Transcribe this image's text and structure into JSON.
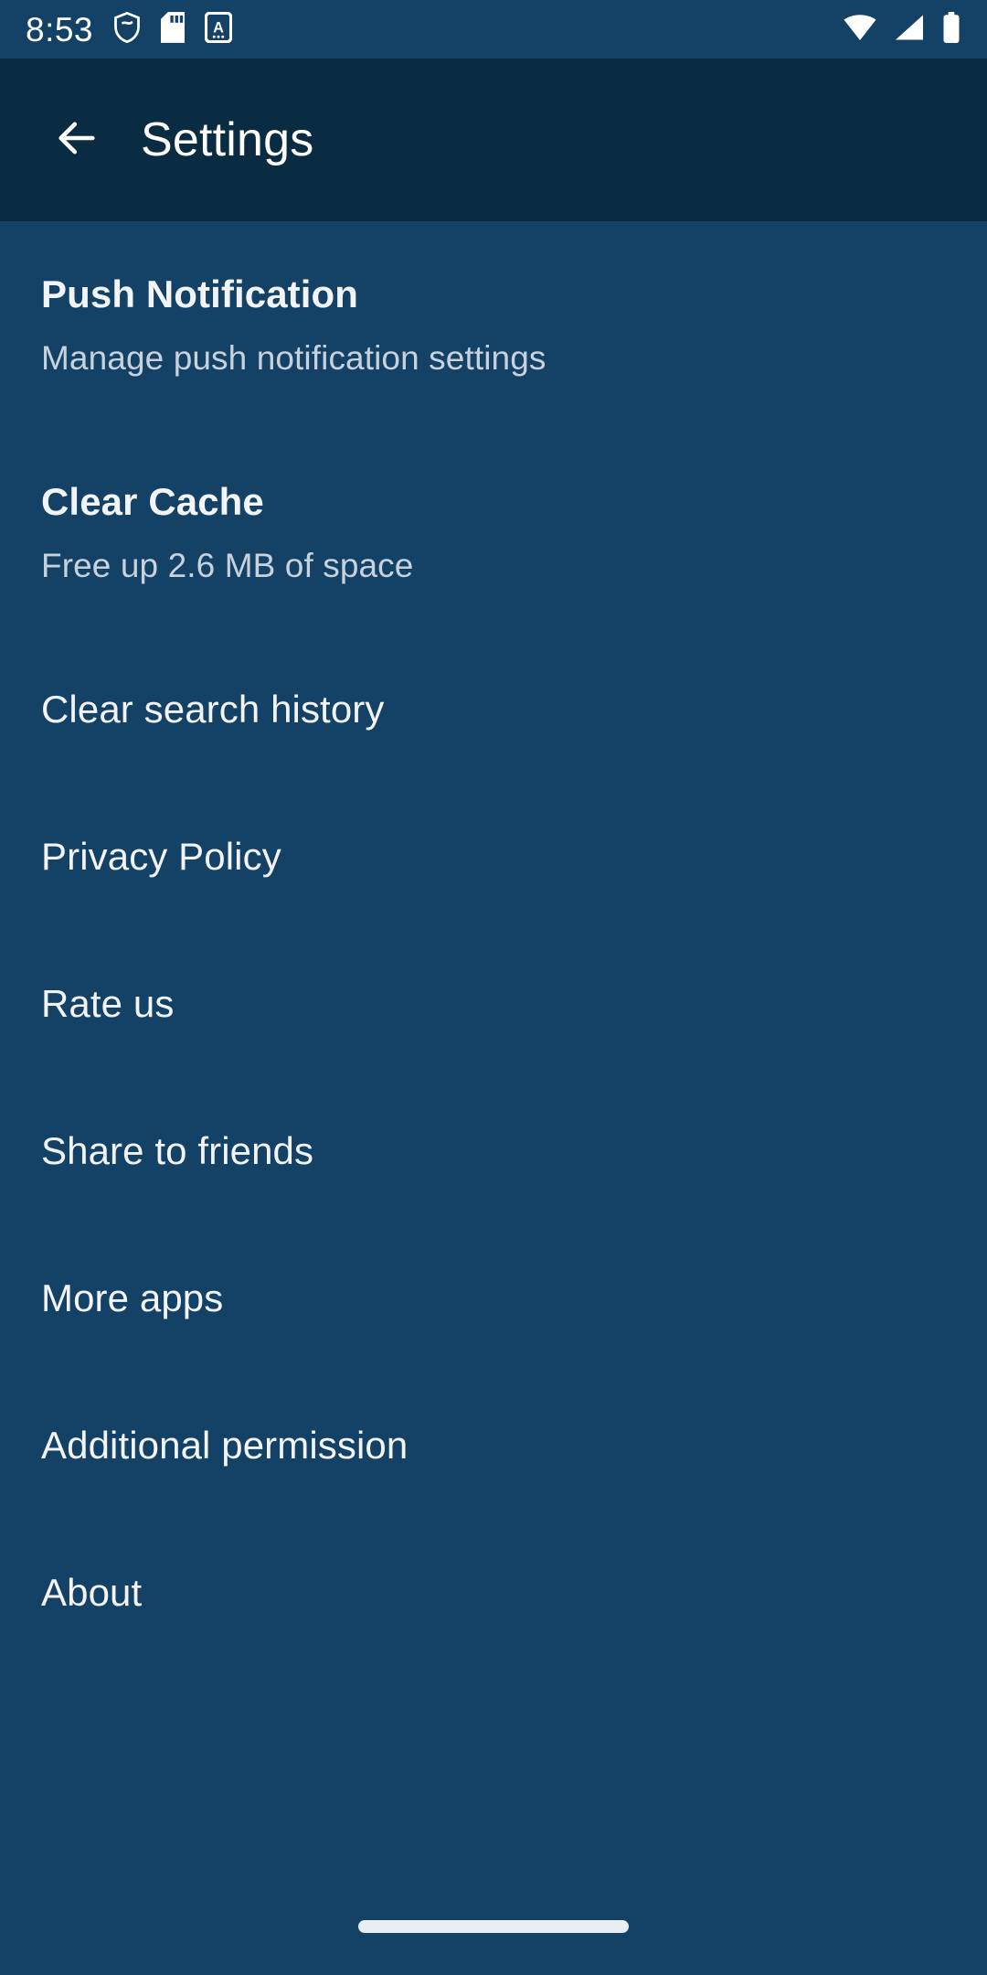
{
  "status_bar": {
    "time": "8:53",
    "left_icons": [
      {
        "name": "shield-icon",
        "label": "shield"
      },
      {
        "name": "sd-card-icon",
        "label": "sd card"
      },
      {
        "name": "keyboard-language-icon",
        "label": "A"
      }
    ],
    "right_icons": [
      {
        "name": "wifi-icon",
        "label": "wifi"
      },
      {
        "name": "cellular-signal-icon",
        "label": "signal"
      },
      {
        "name": "battery-icon",
        "label": "battery full"
      }
    ]
  },
  "app_bar": {
    "back_label": "Back",
    "title": "Settings"
  },
  "settings_list": {
    "items": [
      {
        "name": "push-notification",
        "title": "Push Notification",
        "subtitle": "Manage push notification settings"
      },
      {
        "name": "clear-cache",
        "title": "Clear Cache",
        "subtitle": "Free up 2.6 MB of space"
      },
      {
        "name": "clear-search-history",
        "title": "Clear search history"
      },
      {
        "name": "privacy-policy",
        "title": "Privacy Policy"
      },
      {
        "name": "rate-us",
        "title": "Rate us"
      },
      {
        "name": "share-to-friends",
        "title": "Share to friends"
      },
      {
        "name": "more-apps",
        "title": "More apps"
      },
      {
        "name": "additional-permission",
        "title": "Additional permission"
      },
      {
        "name": "about",
        "title": "About"
      }
    ]
  },
  "nav_bar": {
    "gesture_pill_label": "Home gesture bar"
  },
  "colors": {
    "status_bar_bg": "#144166",
    "app_bar_bg": "#0a2c42",
    "content_bg": "#144166",
    "title_text": "#f2f4f7",
    "subtitle_text": "#c7d2dd",
    "icon_white": "#ffffff"
  }
}
